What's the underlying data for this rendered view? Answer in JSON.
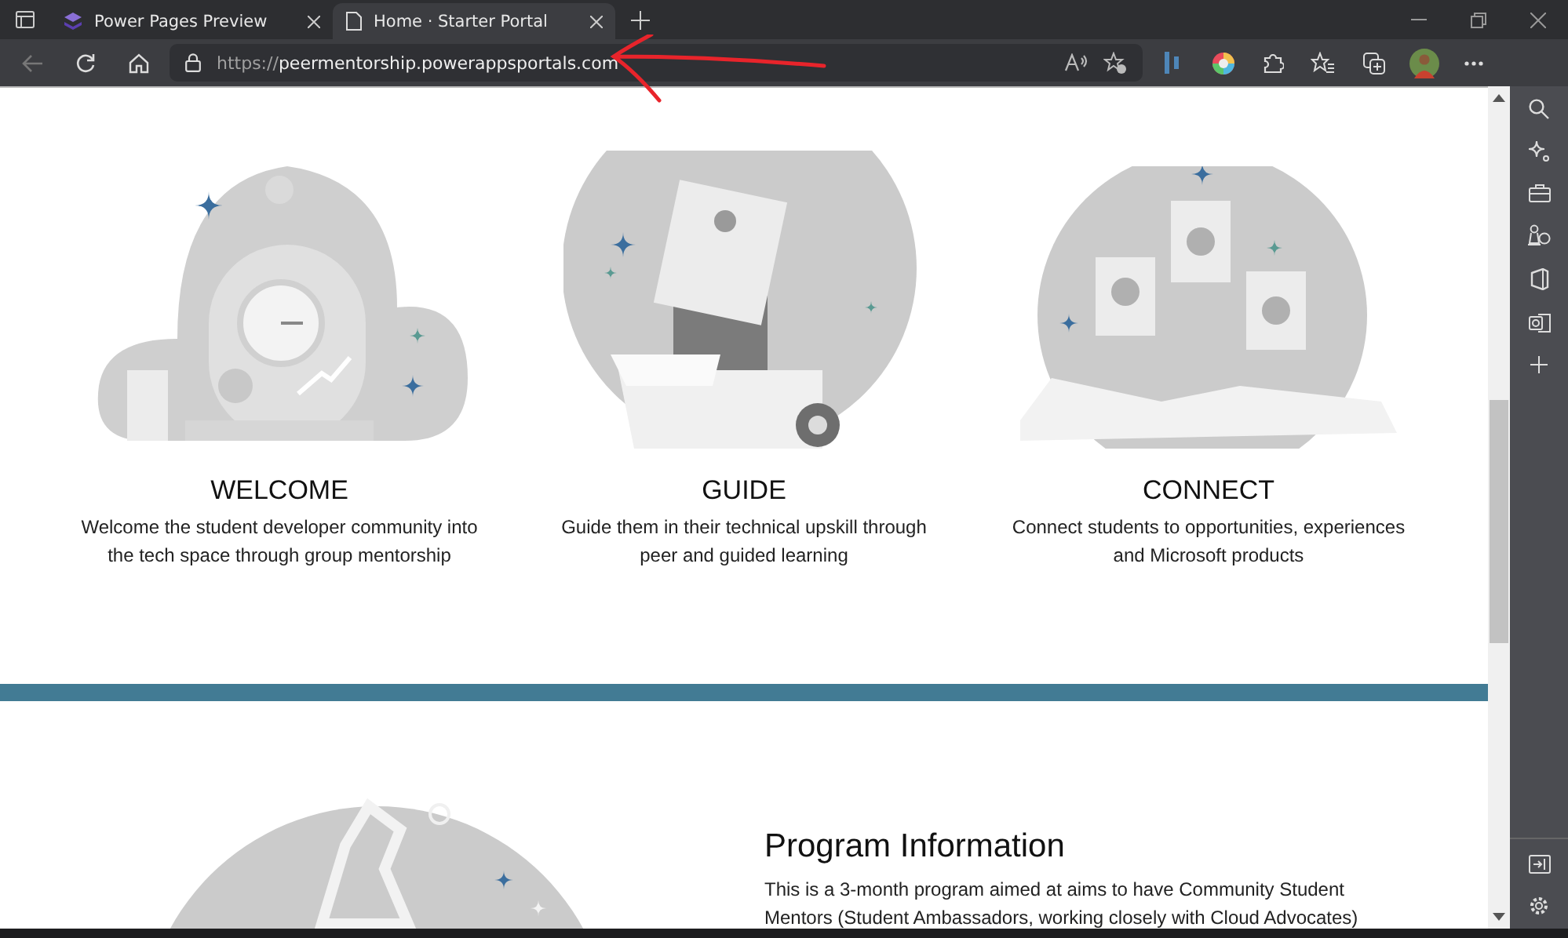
{
  "tabs": [
    {
      "kind": "app",
      "title": "Power Pages Preview",
      "selected": false
    },
    {
      "kind": "page",
      "title": "Home · Starter Portal",
      "selected": true
    }
  ],
  "toolbar": {
    "back_disabled": true,
    "address": {
      "scheme": "https://",
      "host": "peermentorship.powerappsportals.com"
    }
  },
  "features": [
    {
      "kind": "stopwatch",
      "title": "WELCOME",
      "description": [
        "Welcome the student developer community into",
        "the tech space through group mentorship"
      ]
    },
    {
      "kind": "box",
      "title": "GUIDE",
      "description": [
        "Guide them in their technical upskill through",
        "peer and guided learning"
      ]
    },
    {
      "kind": "cards",
      "title": "CONNECT",
      "description": [
        "Connect students to opportunities, experiences",
        "and Microsoft products"
      ]
    }
  ],
  "program": {
    "heading": "Program Information",
    "lines": [
      "This is a 3-month program aimed at aims to have Community Student",
      "Mentors (Student Ambassadors, working closely with Cloud Advocates)"
    ]
  }
}
